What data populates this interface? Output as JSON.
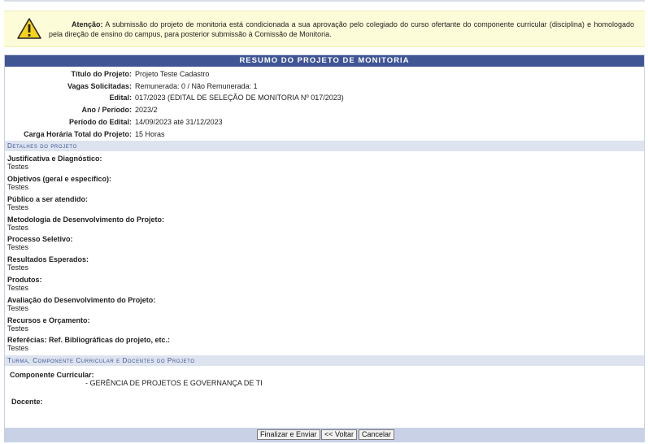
{
  "alert": {
    "icon": "warning-icon",
    "title": "Atenção:",
    "message": "A submissão do projeto de monitoria está condicionada a sua aprovação pelo colegiado do curso ofertante do componente curricular (disciplina) e homologado pela direção de ensino do campus, para posterior submissão à Comissão de Monitoria."
  },
  "summary": {
    "header": "RESUMO DO PROJETO DE MONITORIA",
    "rows": [
      {
        "label": "Título do Projeto:",
        "value": "Projeto Teste Cadastro"
      },
      {
        "label": "Vagas Solicitadas:",
        "value": "Remunerada: 0 / Não Remunerada: 1"
      },
      {
        "label": "Edital:",
        "value": "017/2023 (EDITAL DE SELEÇÃO DE MONITORIA Nº 017/2023)"
      },
      {
        "label": "Ano / Período:",
        "value": "2023/2"
      },
      {
        "label": "Período do Edital:",
        "value": "14/09/2023 até 31/12/2023"
      },
      {
        "label": "Carga Horária Total do Projeto:",
        "value": "15 Horas"
      }
    ]
  },
  "details": {
    "header": "Detalhes do projeto",
    "items": [
      {
        "label": "Justificativa e Diagnóstico:",
        "value": "Testes"
      },
      {
        "label": "Objetivos (geral e específico):",
        "value": "Testes"
      },
      {
        "label": "Público a ser atendido:",
        "value": "Testes"
      },
      {
        "label": "Metodologia de Desenvolvimento do Projeto:",
        "value": "Testes"
      },
      {
        "label": "Processo Seletivo:",
        "value": "Testes"
      },
      {
        "label": "Resultados Esperados:",
        "value": "Testes"
      },
      {
        "label": "Produtos:",
        "value": "Testes"
      },
      {
        "label": "Avaliação do Desenvolvimento do Projeto:",
        "value": "Testes"
      },
      {
        "label": "Recursos e Orçamento:",
        "value": "Testes"
      },
      {
        "label": "Referêcias: Ref. Bibliográficas do projeto, etc.:",
        "value": "Testes"
      }
    ]
  },
  "turma": {
    "header": "Turma, Componente Curricular e Docentes do Projeto",
    "component_label": "Componente Curricular:",
    "component_value": "- GERÊNCIA DE PROJETOS E GOVERNANÇA DE TI",
    "docente_label": "Docente:"
  },
  "buttons": {
    "submit": "Finalizar e Enviar",
    "back": "<< Voltar",
    "cancel": "Cancelar"
  },
  "colors": {
    "header_bg": "#3f5594",
    "subheader_bg": "#dde3ef",
    "alert_bg": "#fdfcd8",
    "footer_bg": "#c8d1e6"
  }
}
